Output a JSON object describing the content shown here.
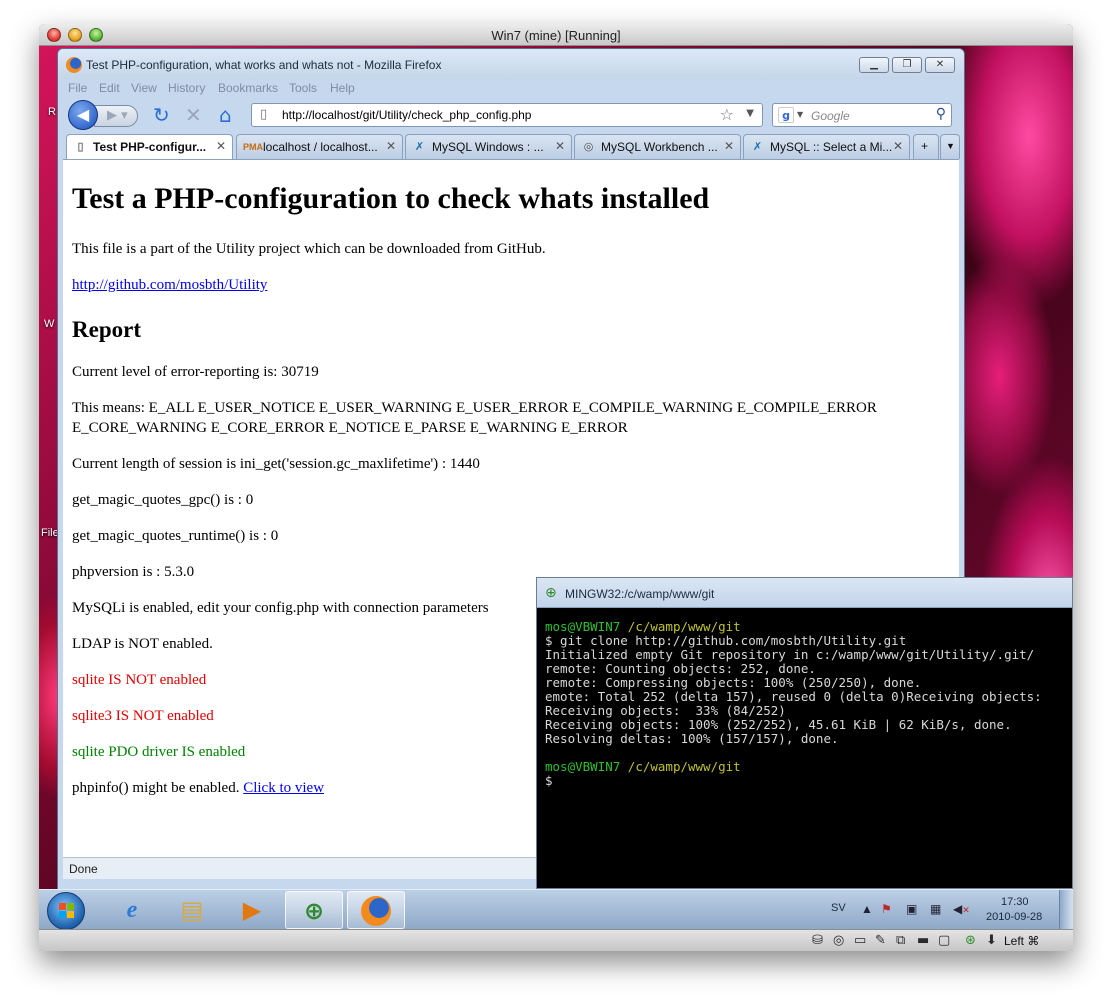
{
  "vbox": {
    "title": "Win7 (mine) [Running]",
    "hostkey": "Left ⌘"
  },
  "desktop": {
    "labels": [
      "R",
      "W",
      "File"
    ]
  },
  "firefox": {
    "title": "Test PHP-configuration, what works and whats not - Mozilla Firefox",
    "menu": [
      "File",
      "Edit",
      "View",
      "History",
      "Bookmarks",
      "Tools",
      "Help"
    ],
    "url": "http://localhost/git/Utility/check_php_config.php",
    "search_placeholder": "Google",
    "tabs": [
      {
        "label": "Test PHP-configur...",
        "icon": "page-icon",
        "active": true
      },
      {
        "label": "localhost / localhost...",
        "icon": "pma-icon",
        "active": false
      },
      {
        "label": "MySQL Windows : ...",
        "icon": "mysql-dolphin-icon",
        "active": false
      },
      {
        "label": "MySQL Workbench ...",
        "icon": "workbench-icon",
        "active": false
      },
      {
        "label": "MySQL :: Select a Mi...",
        "icon": "mysql-dolphin-icon",
        "active": false
      }
    ],
    "new_tab": "+",
    "status": "Done",
    "page": {
      "h1": "Test a PHP-configuration to check whats installed",
      "intro": "This file is a part of the Utility project which can be downloaded from GitHub.",
      "github_link": "http://github.com/mosbth/Utility",
      "h2": "Report",
      "lines": [
        "Current level of error-reporting is: 30719",
        "This means: E_ALL E_USER_NOTICE E_USER_WARNING E_USER_ERROR E_COMPILE_WARNING E_COMPILE_ERROR E_CORE_WARNING E_CORE_ERROR E_NOTICE E_PARSE E_WARNING E_ERROR",
        "Current length of session is ini_get('session.gc_maxlifetime') : 1440",
        "get_magic_quotes_gpc() is : 0",
        "get_magic_quotes_runtime() is : 0",
        "phpversion is : 5.3.0",
        "MySQLi is enabled, edit your config.php with connection parameters",
        "LDAP is NOT enabled.",
        "sqlite IS NOT enabled",
        "sqlite3 IS NOT enabled",
        "sqlite PDO driver IS enabled"
      ],
      "phpinfo_text": "phpinfo() might be enabled.",
      "phpinfo_link": "Click to view",
      "colors": {
        "error": "#e00000",
        "ok": "#008000",
        "link": "#0000ee"
      }
    }
  },
  "terminal": {
    "title": "MINGW32:/c/wamp/www/git",
    "prompt_user": "mos@VBWIN7",
    "prompt_path": "/c/wamp/www/git",
    "output": [
      "$ git clone http://github.com/mosbth/Utility.git",
      "Initialized empty Git repository in c:/wamp/www/git/Utility/.git/",
      "remote: Counting objects: 252, done.",
      "remote: Compressing objects: 100% (250/250), done.",
      "emote: Total 252 (delta 157), reused 0 (delta 0)Receiving objects:",
      "Receiving objects:  33% (84/252)",
      "Receiving objects: 100% (252/252), 45.61 KiB | 62 KiB/s, done.",
      "Resolving deltas: 100% (157/157), done."
    ],
    "prompt2_user": "mos@VBWIN7",
    "prompt2_path": "/c/wamp/www/git",
    "cursor_line": "$"
  },
  "taskbar": {
    "language": "SV",
    "time": "17:30",
    "date": "2010-09-28",
    "items": [
      "ie-icon",
      "explorer-icon",
      "media-player-icon",
      "git-gui-icon",
      "firefox-icon"
    ]
  }
}
